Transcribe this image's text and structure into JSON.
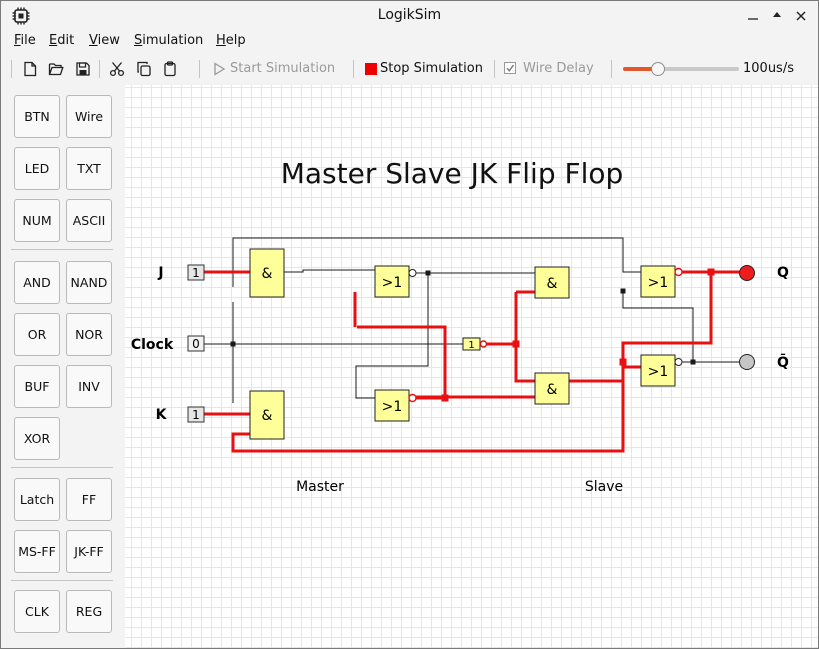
{
  "window": {
    "title": "LogikSim"
  },
  "menu": [
    {
      "label": "File",
      "underline": "F",
      "rest": "ile"
    },
    {
      "label": "Edit",
      "underline": "E",
      "rest": "dit"
    },
    {
      "label": "View",
      "underline": "V",
      "rest": "iew"
    },
    {
      "label": "Simulation",
      "underline": "S",
      "rest": "imulation"
    },
    {
      "label": "Help",
      "underline": "H",
      "rest": "elp"
    }
  ],
  "toolbar": {
    "start_simulation": "Start Simulation",
    "stop_simulation": "Stop Simulation",
    "wire_delay": "Wire Delay",
    "wire_delay_checked": true,
    "speed_label": "100us/s",
    "speed_fraction": 0.3
  },
  "palette": [
    [
      "BTN",
      "Wire"
    ],
    [
      "LED",
      "TXT"
    ],
    [
      "NUM",
      "ASCII"
    ],
    [
      "AND",
      "NAND"
    ],
    [
      "OR",
      "NOR"
    ],
    [
      "BUF",
      "INV"
    ],
    [
      "XOR",
      ""
    ],
    [
      "Latch",
      "FF"
    ],
    [
      "MS-FF",
      "JK-FF"
    ],
    [
      "CLK",
      "REG"
    ]
  ],
  "circuit": {
    "title": "Master Slave JK Flip Flop",
    "labels": {
      "j": "J",
      "clock": "Clock",
      "k": "K",
      "q": "Q",
      "qbar": "Q̄",
      "master": "Master",
      "slave": "Slave"
    },
    "inputs": {
      "j": "1",
      "clock": "0",
      "k": "1"
    },
    "gates": {
      "master_and_top": "&",
      "master_and_bottom": "&",
      "master_or_top": ">1",
      "master_or_bottom": ">1",
      "inverter": "1",
      "slave_and_top": "&",
      "slave_and_bottom": "&",
      "slave_or_top": ">1",
      "slave_or_bottom": ">1"
    },
    "colors": {
      "active": "#e81010",
      "inactive": "#1a1a1a",
      "gate_fill": "#ffff99",
      "led_on": "#ee1c1c",
      "led_off": "#c6c6c6"
    },
    "outputs": {
      "q_led_on": true,
      "qbar_led_on": false
    }
  }
}
